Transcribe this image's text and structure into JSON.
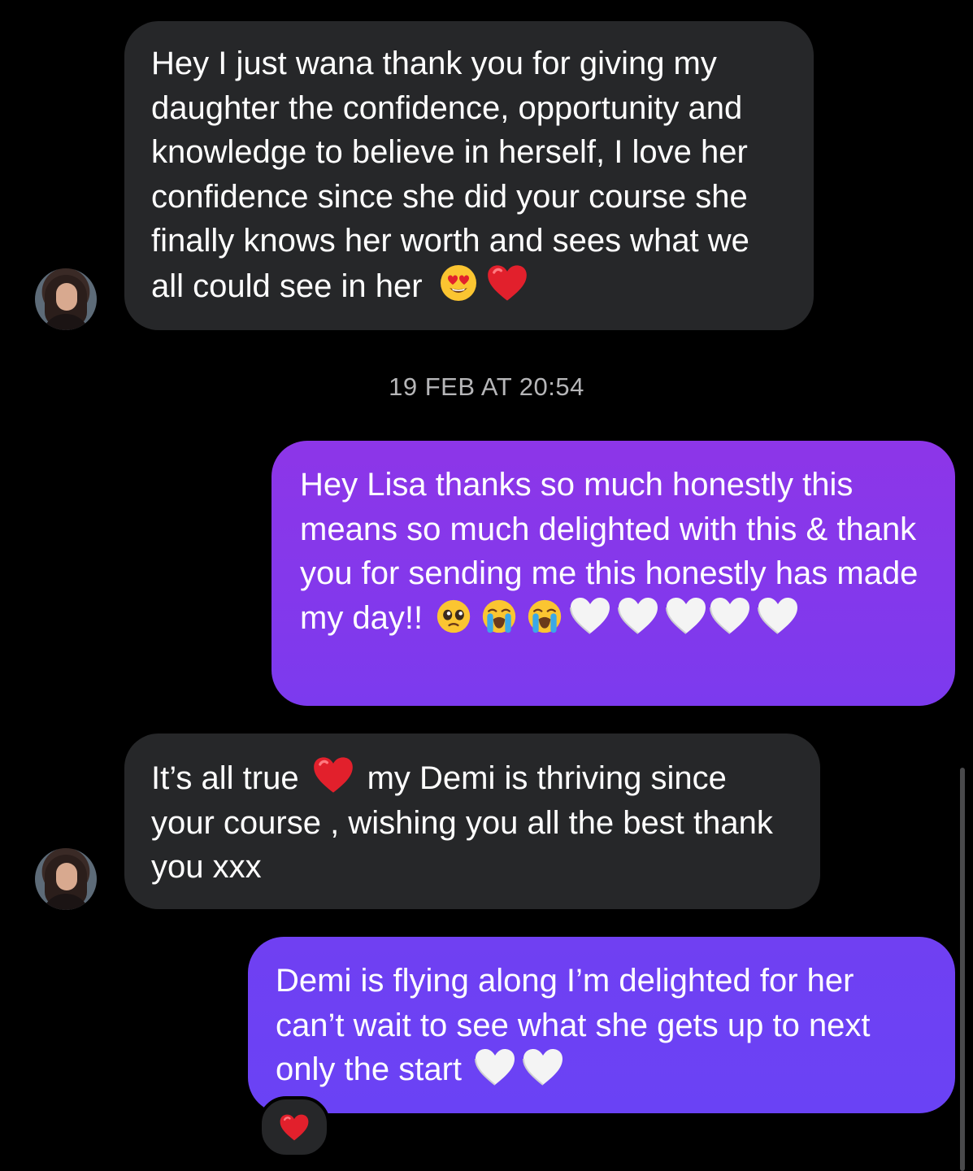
{
  "messages": [
    {
      "side": "incoming",
      "text": "Hey I just wana thank you for giving my daughter the confidence, opportunity and knowledge to believe in herself, I love her confidence since she did your course she finally knows her worth and sees what we all could see in her",
      "emojis": [
        "heart-eyes",
        "red-heart"
      ]
    },
    {
      "side": "outgoing",
      "text": "Hey Lisa thanks so much honestly this means so much delighted with this & thank you for sending me this honestly has made my day!!",
      "emojis": [
        "pleading-face",
        "crying-face",
        "crying-face",
        "white-heart",
        "white-heart",
        "white-heart",
        "white-heart",
        "white-heart"
      ]
    },
    {
      "side": "incoming",
      "text_before_emoji": "It’s all true",
      "text_after_emoji": "my Demi is thriving since your course , wishing you all the best thank you xxx",
      "emojis": [
        "red-heart"
      ]
    },
    {
      "side": "outgoing",
      "text": "Demi is flying along I’m delighted for her can’t wait to see what she gets up to next only the start",
      "emojis": [
        "white-heart",
        "white-heart"
      ],
      "reaction": "red-heart"
    }
  ],
  "timestamp": "19 FEB AT 20:54",
  "colors": {
    "background": "#000000",
    "incoming_bubble": "#262729",
    "outgoing_gradient_top": "#8d36e8",
    "outgoing_gradient_bottom": "#6a42f5",
    "timestamp_text": "#b6b6b8"
  }
}
